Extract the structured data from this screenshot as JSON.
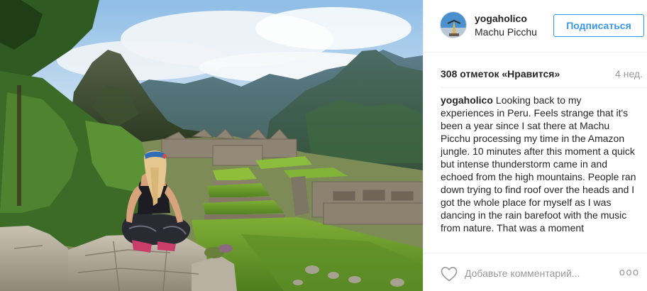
{
  "header": {
    "username": "yogaholico",
    "location": "Machu Picchu",
    "follow_label": "Подписаться"
  },
  "stats": {
    "likes": "308 отметок «Нравится»",
    "time_ago": "4 нед."
  },
  "caption": {
    "username": "yogaholico",
    "text": "Looking back to my experiences in Peru. Feels strange that it's been a year since I sat there at Machu Picchu processing my time in the Amazon jungle. 10 minutes after this moment a quick but intense thunderstorm came in and echoed from the high mountains. People ran down trying to find roof over the heads and I got the whole place for myself as I was dancing in the rain barefoot with the music from nature. That was a moment"
  },
  "footer": {
    "comment_placeholder": "Добавьте комментарий...",
    "more_label": "ooo"
  },
  "icons": {
    "like": "heart-icon",
    "more": "more-options-icon"
  },
  "colors": {
    "accent": "#3897f0",
    "text": "#262626",
    "muted": "#999999",
    "border": "#efefef"
  }
}
